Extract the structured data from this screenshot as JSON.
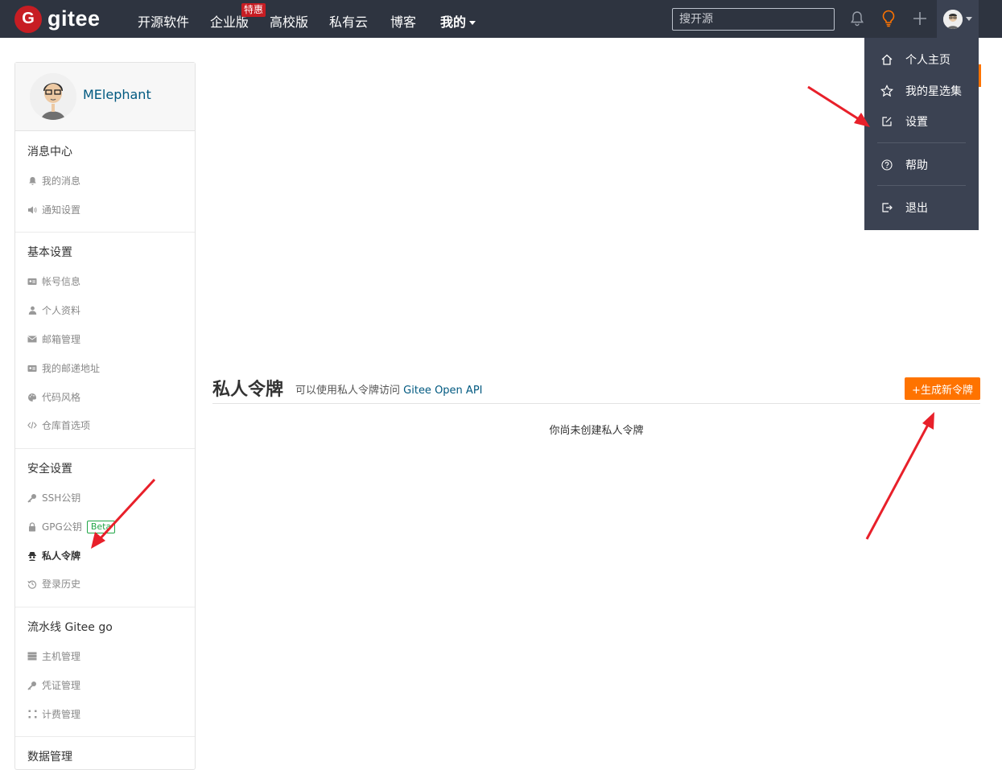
{
  "brand": {
    "logo_letter": "G",
    "logo_text": "gitee"
  },
  "topnav": {
    "items": [
      {
        "label": "开源软件"
      },
      {
        "label": "企业版",
        "badge": "特惠"
      },
      {
        "label": "高校版"
      },
      {
        "label": "私有云"
      },
      {
        "label": "博客"
      },
      {
        "label": "我的"
      }
    ],
    "search_placeholder": "搜开源",
    "icons": [
      "bell-icon",
      "lightbulb-icon",
      "plus-icon",
      "avatar"
    ]
  },
  "user_dropdown": {
    "items": [
      {
        "icon": "home-icon",
        "label": "个人主页"
      },
      {
        "icon": "star-icon",
        "label": "我的星选集"
      },
      {
        "icon": "edit-icon",
        "label": "设置"
      },
      {
        "icon": "help-icon",
        "label": "帮助"
      },
      {
        "icon": "logout-icon",
        "label": "退出"
      }
    ]
  },
  "sidebar": {
    "username": "MElephant",
    "groups": [
      {
        "title": "消息中心",
        "items": [
          {
            "icon": "bell-icon",
            "label": "我的消息"
          },
          {
            "icon": "speaker-icon",
            "label": "通知设置"
          }
        ]
      },
      {
        "title": "基本设置",
        "items": [
          {
            "icon": "id-card-icon",
            "label": "帐号信息"
          },
          {
            "icon": "user-icon",
            "label": "个人资料"
          },
          {
            "icon": "mail-icon",
            "label": "邮箱管理"
          },
          {
            "icon": "address-card-icon",
            "label": "我的邮递地址"
          },
          {
            "icon": "palette-icon",
            "label": "代码风格"
          },
          {
            "icon": "code-icon",
            "label": "仓库首选项"
          }
        ]
      },
      {
        "title": "安全设置",
        "items": [
          {
            "icon": "key-icon",
            "label": "SSH公钥"
          },
          {
            "icon": "lock-icon",
            "label": "GPG公钥",
            "badge": "Beta"
          },
          {
            "icon": "spy-icon",
            "label": "私人令牌",
            "active": true
          },
          {
            "icon": "history-icon",
            "label": "登录历史"
          }
        ]
      },
      {
        "title": "流水线 Gitee go",
        "items": [
          {
            "icon": "server-icon",
            "label": "主机管理"
          },
          {
            "icon": "key-icon",
            "label": "凭证管理"
          },
          {
            "icon": "grid-dots-icon",
            "label": "计费管理"
          }
        ]
      },
      {
        "title": "数据管理",
        "items": []
      }
    ]
  },
  "main": {
    "title": "私人令牌",
    "subtitle_prefix": "可以使用私人令牌访问",
    "subtitle_link": "Gitee Open API",
    "generate_button": "+生成新令牌",
    "empty_message": "你尚未创建私人令牌"
  },
  "colors": {
    "nav_bg": "#2e3440",
    "dropdown_bg": "#3b4252",
    "brand_red": "#c71d23",
    "accent_orange": "#fe7300",
    "link_blue": "#005980",
    "beta_green": "#21a647",
    "annotation_red": "#e8202a"
  }
}
